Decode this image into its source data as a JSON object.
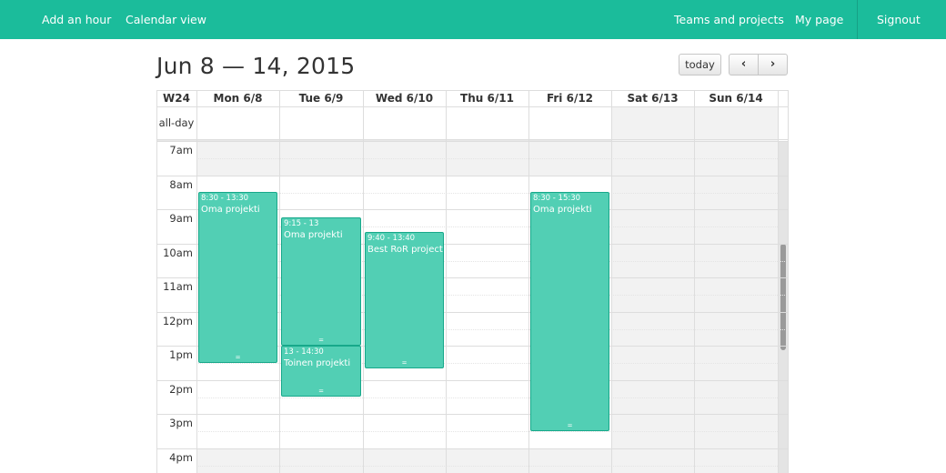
{
  "nav": {
    "add_hour": "Add an hour",
    "calendar_view": "Calendar view",
    "teams_projects": "Teams and projects",
    "my_page": "My page",
    "signout": "Signout"
  },
  "calendar": {
    "title": "Jun 8 — 14, 2015",
    "today_label": "today",
    "prev_label": "‹",
    "next_label": "›",
    "week_label": "W24",
    "allday_label": "all-day",
    "days": [
      "Mon 6/8",
      "Tue 6/9",
      "Wed 6/10",
      "Thu 6/11",
      "Fri 6/12",
      "Sat 6/13",
      "Sun 6/14"
    ],
    "hours": [
      "7am",
      "8am",
      "9am",
      "10am",
      "11am",
      "12pm",
      "1pm",
      "2pm",
      "3pm",
      "4pm"
    ],
    "events": [
      {
        "day": 0,
        "start": 8.5,
        "end": 13.5,
        "time": "8:30 - 13:30",
        "title": "Oma projekti"
      },
      {
        "day": 1,
        "start": 9.25,
        "end": 13.0,
        "time": "9:15 - 13",
        "title": "Oma projekti"
      },
      {
        "day": 1,
        "start": 13.0,
        "end": 14.5,
        "time": "13 - 14:30",
        "title": "Toinen projekti"
      },
      {
        "day": 2,
        "start": 9.6667,
        "end": 13.6667,
        "time": "9:40 - 13:40",
        "title": "Best RoR project"
      },
      {
        "day": 4,
        "start": 8.5,
        "end": 15.5,
        "time": "8:30 - 15:30",
        "title": "Oma projekti"
      }
    ],
    "resize_glyph": "="
  },
  "colors": {
    "navbar": "#1bbc9b",
    "event_bg": "#52cfb4",
    "event_border": "#17a88a"
  }
}
